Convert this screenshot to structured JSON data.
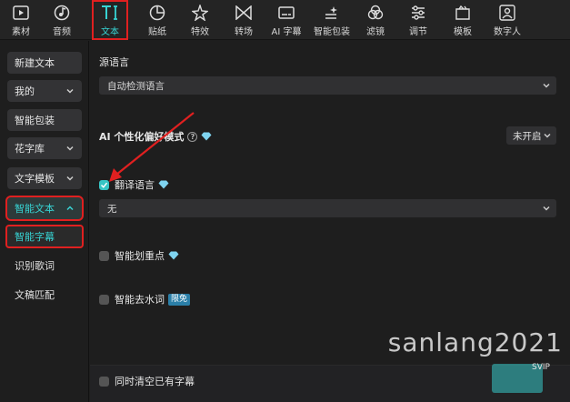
{
  "toolbar": {
    "items": [
      {
        "label": "素材",
        "icon": "media-icon"
      },
      {
        "label": "音频",
        "icon": "music-icon"
      },
      {
        "label": "文本",
        "icon": "text-icon",
        "active": true
      },
      {
        "label": "贴纸",
        "icon": "sticker-icon"
      },
      {
        "label": "特效",
        "icon": "effects-icon"
      },
      {
        "label": "转场",
        "icon": "transition-icon"
      },
      {
        "label": "AI 字幕",
        "icon": "ai-caption-icon"
      },
      {
        "label": "智能包装",
        "icon": "smart-package-icon"
      },
      {
        "label": "滤镜",
        "icon": "filter-icon"
      },
      {
        "label": "调节",
        "icon": "adjust-icon"
      },
      {
        "label": "模板",
        "icon": "template-icon"
      },
      {
        "label": "数字人",
        "icon": "avatar-icon"
      }
    ]
  },
  "sidebar": {
    "new_text": "新建文本",
    "mine": "我的",
    "smart_package": "智能包装",
    "font_library": "花字库",
    "text_template": "文字模板",
    "smart_text": "智能文本",
    "smart_caption": "智能字幕",
    "lyrics": "识别歌词",
    "script_match": "文稿匹配"
  },
  "main": {
    "source_lang_title": "源语言",
    "source_lang_value": "自动检测语言",
    "ai_style_title": "AI 个性化偏好模式",
    "ai_style_value": "未开启",
    "translate_label": "翻译语言",
    "translate_checked": true,
    "translate_value": "无",
    "highlight_label": "智能划重点",
    "filler_label": "智能去水词",
    "filler_badge": "限免",
    "clear_label": "同时清空已有字幕",
    "svip": "SVIP"
  },
  "watermark": "sanlang2021",
  "colors": {
    "accent": "#37d3d3",
    "highlight_box": "#e02020",
    "arrow": "#e02020",
    "diamond": "#7fd4f0"
  }
}
